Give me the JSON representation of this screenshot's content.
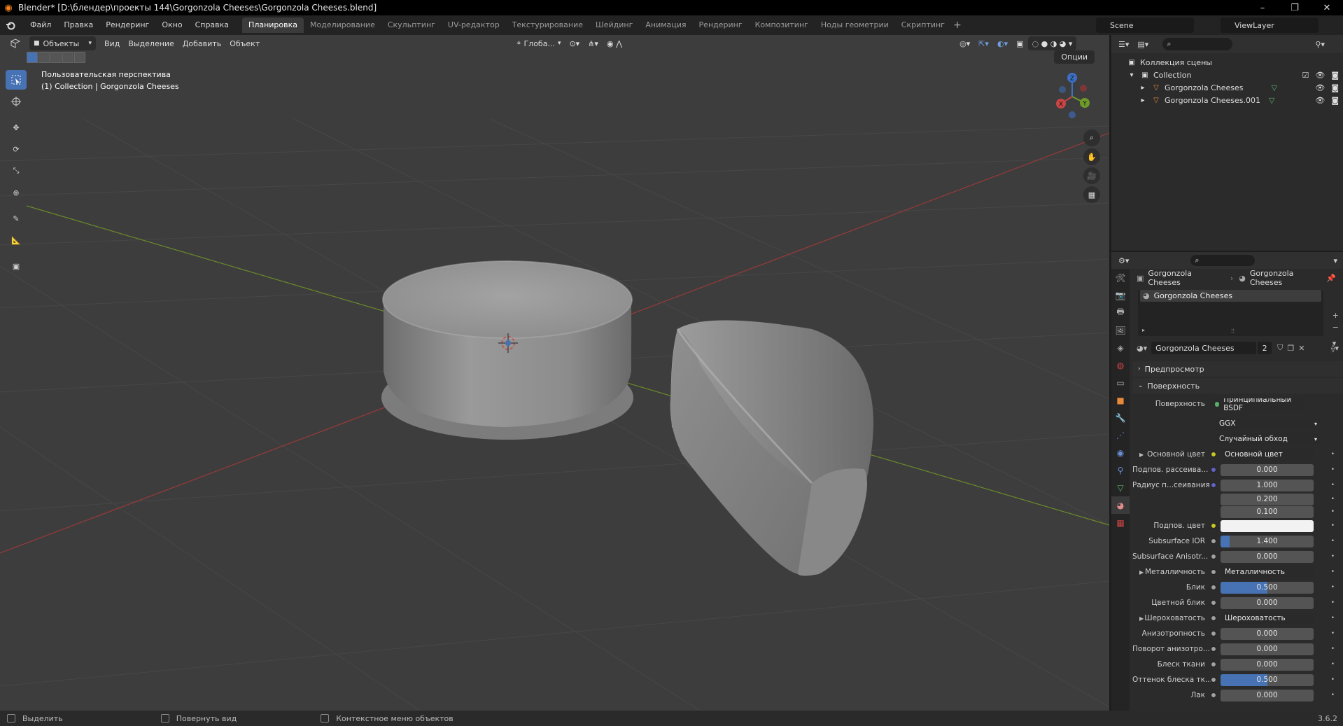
{
  "window": {
    "title": "Blender* [D:\\блендер\\проекты 144\\Gorgonzola Cheeses\\Gorgonzola Cheeses.blend]",
    "controls": [
      "–",
      "❐",
      "✕"
    ]
  },
  "menu": [
    "Файл",
    "Правка",
    "Рендеринг",
    "Окно",
    "Справка"
  ],
  "workspaces": [
    "Планировка",
    "Моделирование",
    "Скульптинг",
    "UV-редактор",
    "Текстурирование",
    "Шейдинг",
    "Анимация",
    "Рендеринг",
    "Композитинг",
    "Ноды геометрии",
    "Скриптинг"
  ],
  "active_workspace": "Планировка",
  "scene": "Scene",
  "view_layer": "ViewLayer",
  "viewport": {
    "mode": "Объекты",
    "header_menu": [
      "Вид",
      "Выделение",
      "Добавить",
      "Объект"
    ],
    "orientation": "Глоба...",
    "options_label": "Опции",
    "info_line1": "Пользовательская перспектива",
    "info_line2": "(1) Collection | Gorgonzola Cheeses"
  },
  "gizmo": {
    "x": "X",
    "y": "Y",
    "z": "Z"
  },
  "outliner": {
    "scene_collection": "Коллекция сцены",
    "collection": "Collection",
    "objects": [
      "Gorgonzola Cheeses",
      "Gorgonzola Cheeses.001"
    ]
  },
  "properties": {
    "breadcrumb_object": "Gorgonzola Cheeses",
    "breadcrumb_material": "Gorgonzola Cheeses",
    "material_slot": "Gorgonzola Cheeses",
    "material_name": "Gorgonzola Cheeses",
    "user_count": "2",
    "panel_preview": "Предпросмотр",
    "panel_surface": "Поверхность",
    "surface_label": "Поверхность",
    "surface_value": "Принципиальный BSDF",
    "distribution": "GGX",
    "subsurface_method": "Случайный обход",
    "rows": [
      {
        "label": "Основной цвет",
        "value": "Основной цвет",
        "type": "link",
        "socket": "#c7c729",
        "expand": true
      },
      {
        "label": "Подпов. рассеива...",
        "value": "0.000",
        "type": "num",
        "socket": "#6363c7"
      },
      {
        "label": "Радиус п...сеивания",
        "value": "1.000",
        "type": "num",
        "socket": "#6363c7"
      },
      {
        "label": "",
        "value": "0.200",
        "type": "num",
        "socket": ""
      },
      {
        "label": "",
        "value": "0.100",
        "type": "num",
        "socket": ""
      },
      {
        "label": "Подпов. цвет",
        "value": "",
        "type": "color",
        "socket": "#c7c729"
      },
      {
        "label": "Subsurface IOR",
        "value": "1.400",
        "type": "num",
        "socket": "#a1a1a1",
        "fill": 0.1
      },
      {
        "label": "Subsurface Anisotr...",
        "value": "0.000",
        "type": "num",
        "socket": "#a1a1a1"
      },
      {
        "label": "Металличность",
        "value": "Металличность",
        "type": "link",
        "socket": "#a1a1a1",
        "expand": true
      },
      {
        "label": "Блик",
        "value": "0.500",
        "type": "num",
        "socket": "#a1a1a1",
        "fill": 0.5
      },
      {
        "label": "Цветной блик",
        "value": "0.000",
        "type": "num",
        "socket": "#a1a1a1"
      },
      {
        "label": "Шероховатость",
        "value": "Шероховатость",
        "type": "link",
        "socket": "#a1a1a1",
        "expand": true
      },
      {
        "label": "Анизотропность",
        "value": "0.000",
        "type": "num",
        "socket": "#a1a1a1"
      },
      {
        "label": "Поворот анизотро...",
        "value": "0.000",
        "type": "num",
        "socket": "#a1a1a1"
      },
      {
        "label": "Блеск ткани",
        "value": "0.000",
        "type": "num",
        "socket": "#a1a1a1"
      },
      {
        "label": "Оттенок блеска тк...",
        "value": "0.500",
        "type": "num",
        "socket": "#a1a1a1",
        "fill": 0.5
      },
      {
        "label": "Лак",
        "value": "0.000",
        "type": "num",
        "socket": "#a1a1a1"
      }
    ]
  },
  "status": {
    "items": [
      "Выделить",
      "Повернуть вид",
      "Контекстное меню объектов"
    ],
    "version": "3.6.2"
  }
}
